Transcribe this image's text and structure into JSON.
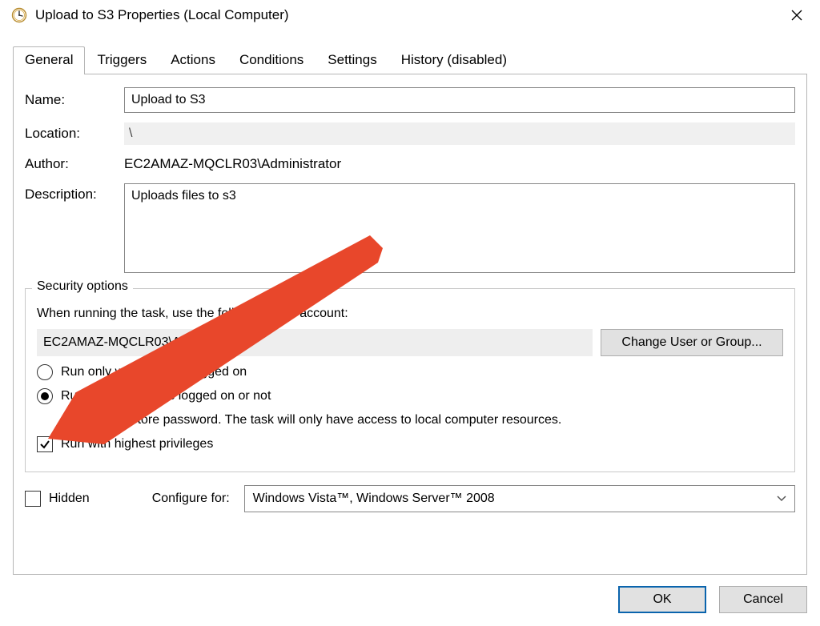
{
  "titlebar": {
    "title": "Upload to S3 Properties (Local Computer)"
  },
  "tabs": {
    "general": "General",
    "triggers": "Triggers",
    "actions": "Actions",
    "conditions": "Conditions",
    "settings": "Settings",
    "history": "History (disabled)"
  },
  "general": {
    "name_label": "Name:",
    "name_value": "Upload to S3",
    "location_label": "Location:",
    "location_value": "\\",
    "author_label": "Author:",
    "author_value": "EC2AMAZ-MQCLR03\\Administrator",
    "description_label": "Description:",
    "description_value": "Uploads files to s3"
  },
  "security": {
    "legend": "Security options",
    "when_running": "When running the task, use the following user account:",
    "account": "EC2AMAZ-MQCLR03\\Administrator",
    "change_btn": "Change User or Group...",
    "run_only_logged_on": "Run only when user is logged on",
    "run_whether": "Run whether user is logged on or not",
    "do_not_store": "Do not store password.  The task will only have access to local computer resources.",
    "highest_priv": "Run with highest privileges"
  },
  "footer": {
    "hidden": "Hidden",
    "configure_for": "Configure for:",
    "configure_value": "Windows Vista™, Windows Server™ 2008"
  },
  "buttons": {
    "ok": "OK",
    "cancel": "Cancel"
  },
  "annotation": {
    "arrow_color": "#e8472b"
  }
}
